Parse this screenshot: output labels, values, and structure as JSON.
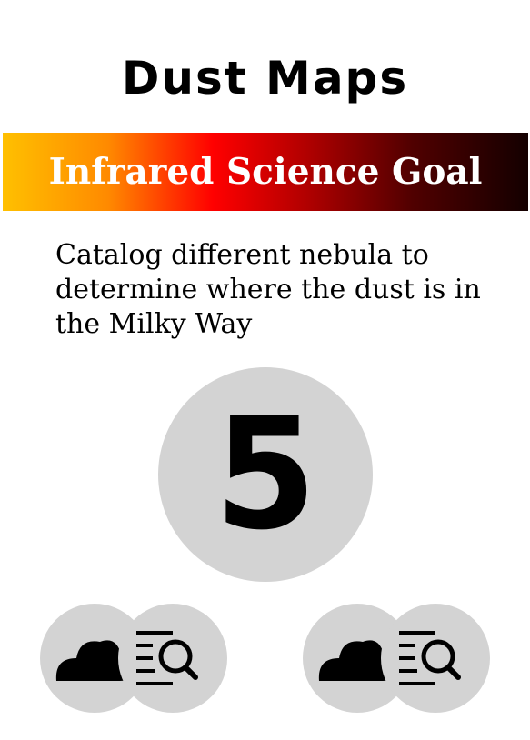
{
  "card": {
    "title": "Dust Maps",
    "banner": "Infrared Science Goal",
    "description": "Catalog different nebula to determine where the dust is in the Milky Way",
    "number": "5"
  },
  "banner_gradient": [
    "#ffc000",
    "#ff0000",
    "#140000"
  ],
  "circle_color": "#d3d3d3",
  "icons": [
    {
      "first": "cloud-icon",
      "second": "search-list-icon"
    },
    {
      "first": "cloud-icon",
      "second": "search-list-icon"
    }
  ]
}
